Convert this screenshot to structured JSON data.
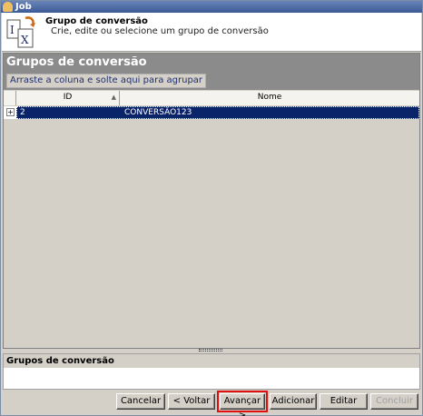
{
  "window": {
    "title": "Job"
  },
  "header": {
    "title": "Grupo de conversão",
    "subtitle": "Crie, edite ou selecione um grupo de conversão"
  },
  "panel": {
    "title": "Grupos de conversão",
    "group_hint": "Arraste a coluna e solte aqui para agrupar"
  },
  "grid": {
    "columns": [
      "ID",
      "Nome"
    ],
    "rows": [
      {
        "id": "2",
        "name": "CONVERSÃO123",
        "selected": true
      }
    ]
  },
  "bottom_panel": {
    "title": "Grupos de conversão"
  },
  "buttons": {
    "cancel": "Cancelar",
    "back": "< Voltar",
    "next": "Avançar >",
    "add": "Adicionar",
    "edit": "Editar",
    "finish": "Concluir"
  },
  "colors": {
    "selection": "#0a246a",
    "panel_header": "#8b8b8b",
    "highlight_outline": "#e01010"
  }
}
